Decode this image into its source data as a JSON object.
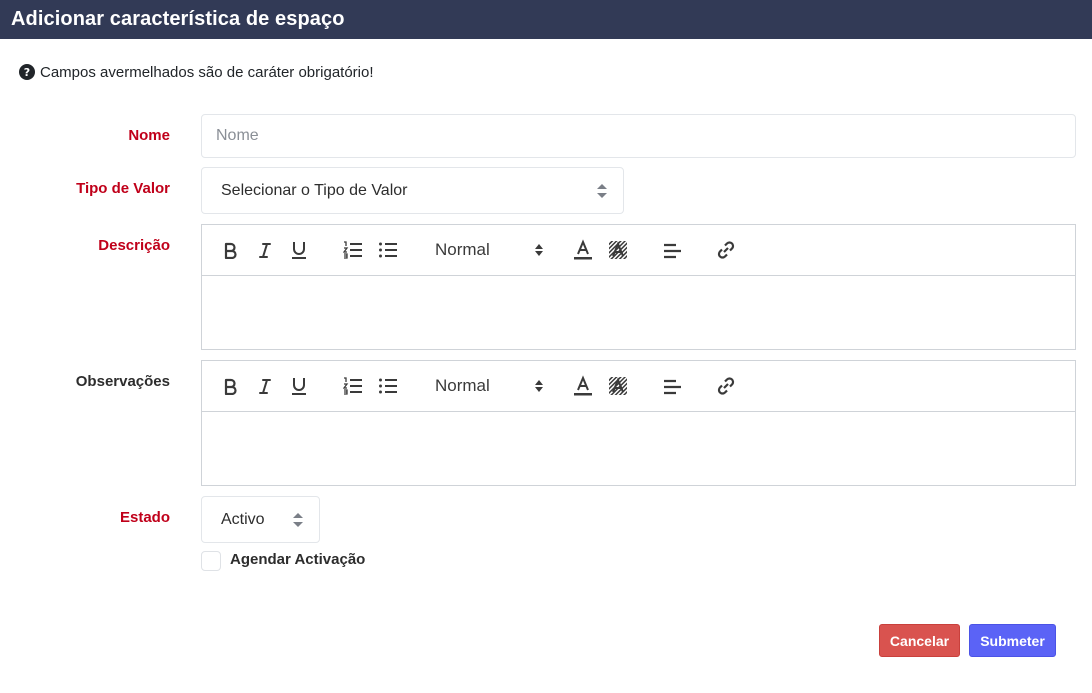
{
  "header": {
    "title": "Adicionar característica de espaço"
  },
  "hint": {
    "icon": "question-circle-icon",
    "text": "Campos avermelhados são de caráter obrigatório!"
  },
  "form": {
    "nome": {
      "label": "Nome",
      "placeholder": "Nome",
      "value": "",
      "required": true
    },
    "tipo_valor": {
      "label": "Tipo de Valor",
      "selected": "Selecionar o Tipo de Valor",
      "required": true
    },
    "descricao": {
      "label": "Descrição",
      "required": true,
      "heading_select": "Normal"
    },
    "observacoes": {
      "label": "Observações",
      "required": false,
      "heading_select": "Normal"
    },
    "estado": {
      "label": "Estado",
      "selected": "Activo",
      "required": true
    },
    "agendar": {
      "label": "Agendar Activação",
      "checked": false
    }
  },
  "toolbar_icons": [
    "bold-icon",
    "italic-icon",
    "underline-icon",
    "ordered-list-icon",
    "bullet-list-icon",
    "text-color-icon",
    "background-color-icon",
    "align-icon",
    "link-icon"
  ],
  "buttons": {
    "cancel": "Cancelar",
    "submit": "Submeter"
  },
  "colors": {
    "header": "#323a56",
    "required": "#c0001a",
    "cancel": "#d9534f",
    "submit": "#5b63f6"
  }
}
